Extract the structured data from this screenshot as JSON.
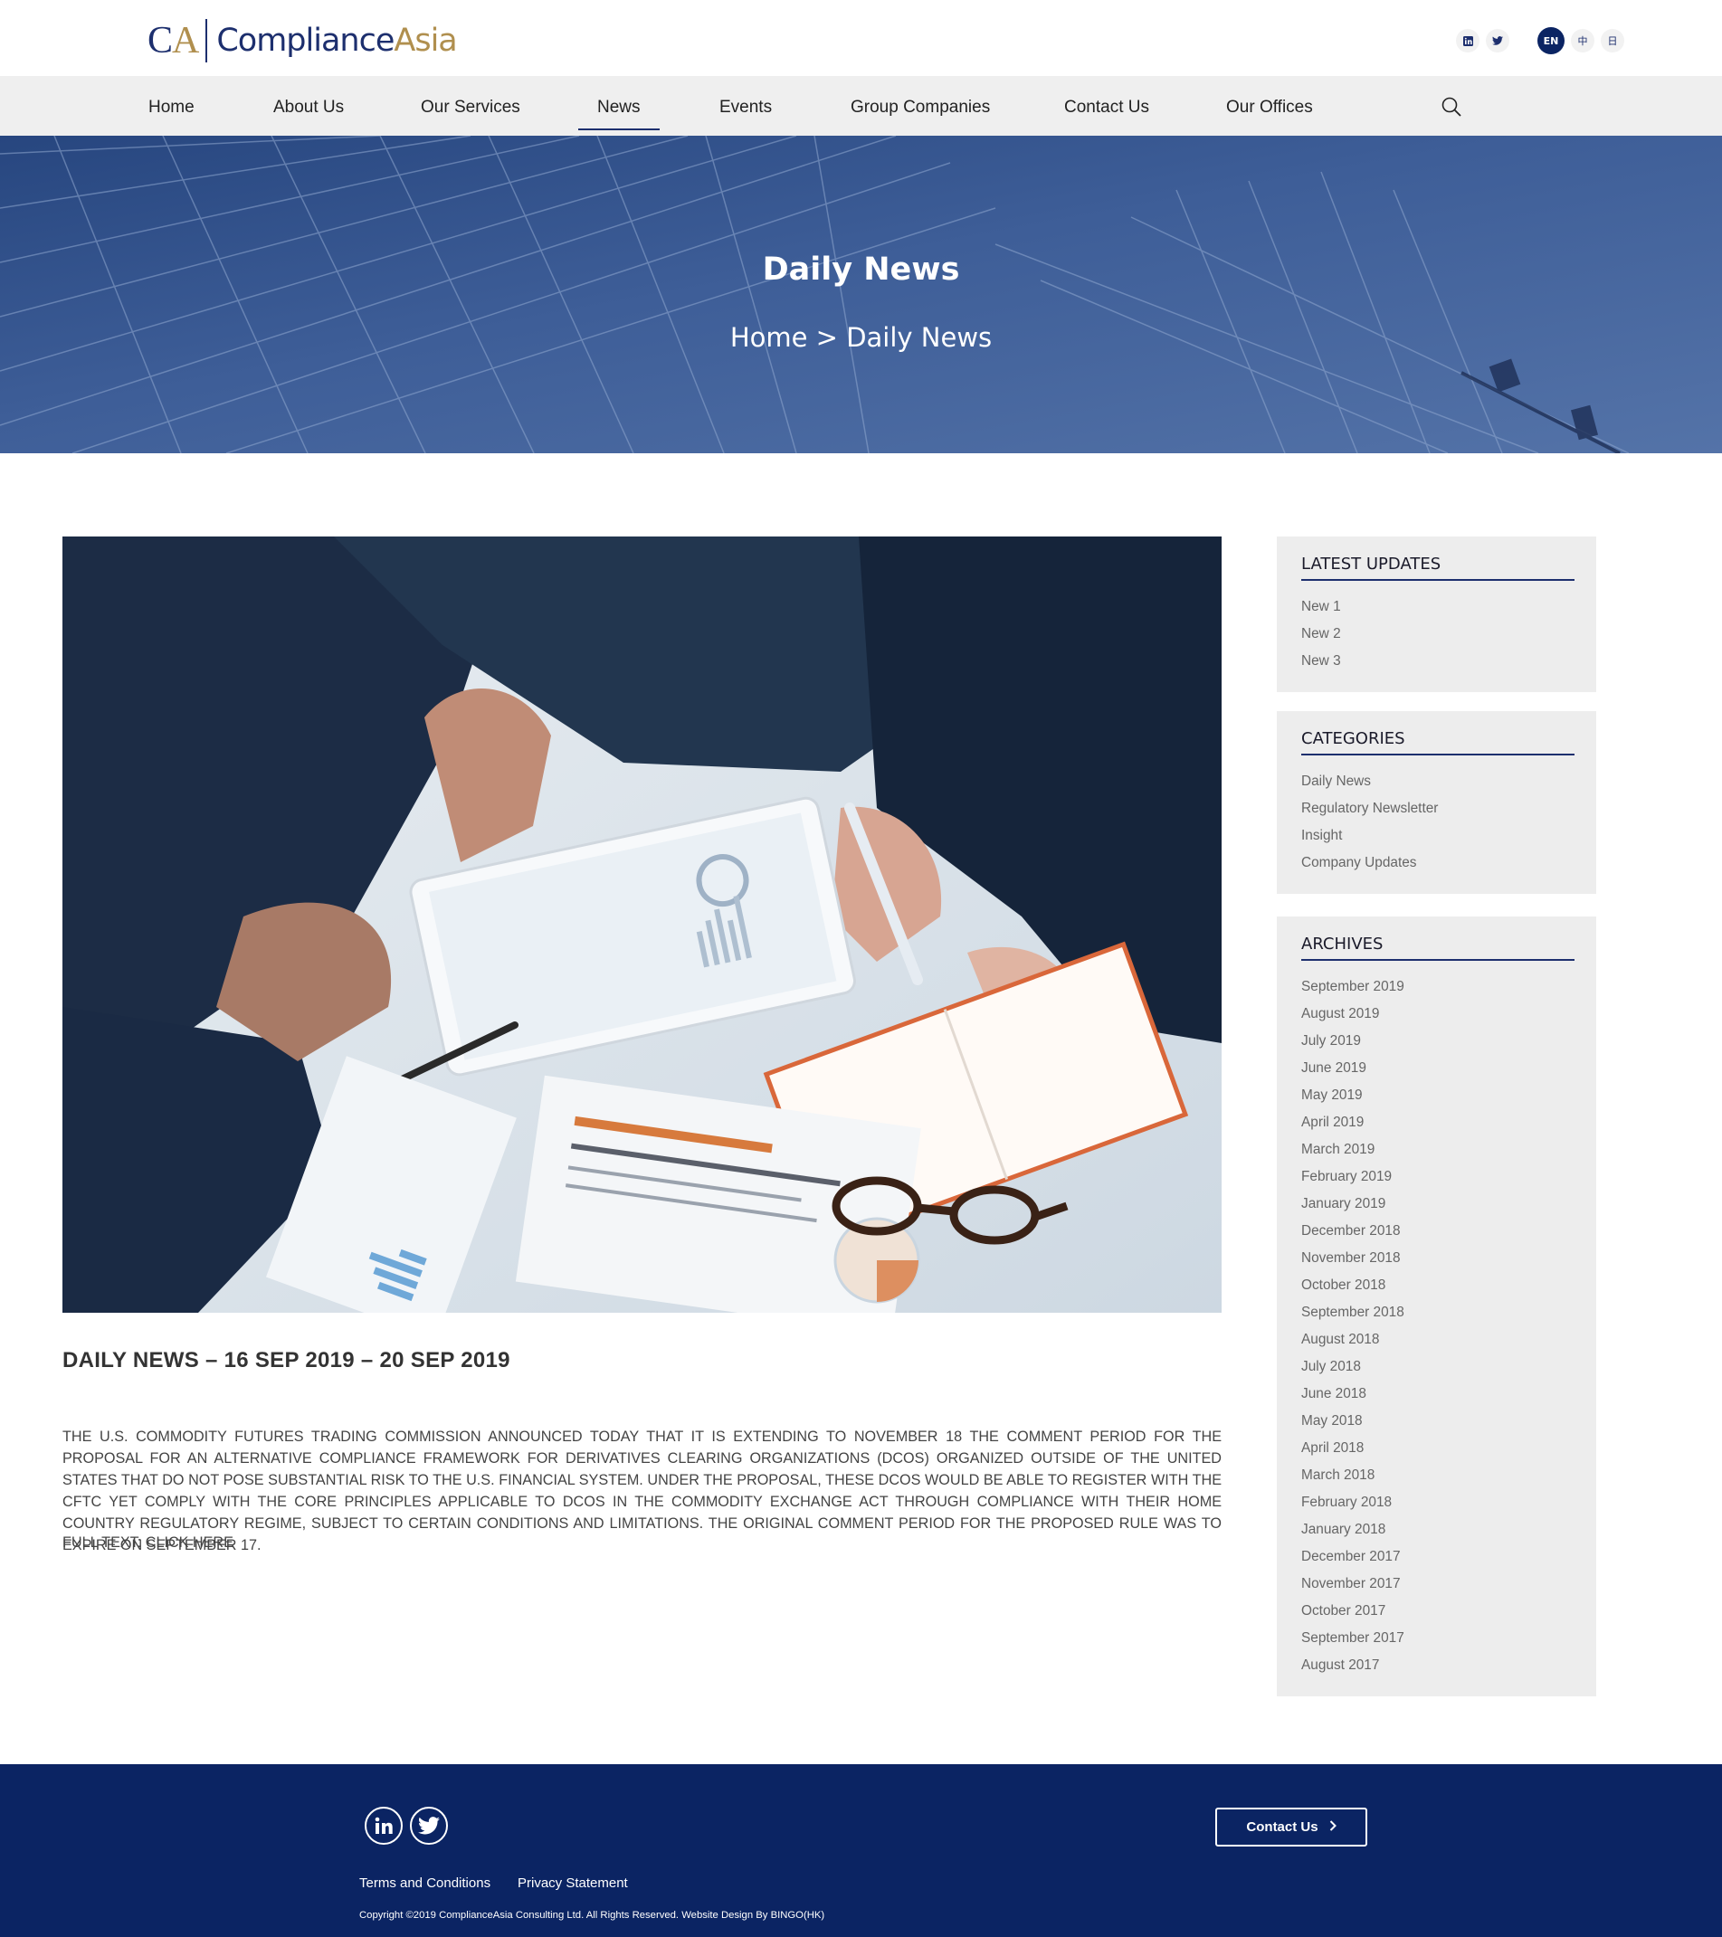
{
  "header": {
    "logo": {
      "mark_left": "C",
      "mark_right": "A",
      "name_main": "Compliance",
      "name_accent": "Asia"
    },
    "social_icons": [
      "linkedin-icon",
      "twitter-icon"
    ],
    "languages": {
      "active": "EN",
      "chinese": "中",
      "japanese": "日"
    }
  },
  "nav": {
    "items": [
      "Home",
      "About Us",
      "Our Services",
      "News",
      "Events",
      "Group Companies",
      "Contact Us",
      "Our Offices"
    ],
    "active": "News",
    "search_icon": "search-icon"
  },
  "banner": {
    "title": "Daily News",
    "breadcrumb": "Home > Daily News"
  },
  "article": {
    "title": "DAILY NEWS – 16 SEP 2019 – 20 SEP 2019",
    "body": "The U.S. Commodity Futures Trading Commission announced today that it is extending to November 18 the comment period for the proposal for an alternative compliance framework for derivatives clearing organizations (DCOs) organized outside of the United States that do not pose substantial risk to the U.S. financial system. Under the proposal, these DCOs would be able to register with the CFTC yet comply with the core principles applicable to DCOs in the Commodity Exchange Act through compliance with their home country regulatory regime, subject to certain conditions and limitations. The original comment period for the proposed rule was to expire on September 17.",
    "full_text_link": "FULL TEXT: CLICK HERE"
  },
  "sidebar": {
    "latest": {
      "title": "LATEST UPDATES",
      "items": [
        "New 1",
        "New 2",
        "New 3"
      ]
    },
    "categories": {
      "title": "CATEGORIES",
      "items": [
        "Daily News",
        "Regulatory Newsletter",
        "Insight",
        "Company Updates"
      ]
    },
    "archives": {
      "title": "ARCHIVES",
      "items": [
        "September 2019",
        "August 2019",
        "July 2019",
        "June 2019",
        "May 2019",
        "April 2019",
        "March 2019",
        "February 2019",
        "January 2019",
        "December 2018",
        "November 2018",
        "October 2018",
        "September 2018",
        "August 2018",
        "July 2018",
        "June 2018",
        "May 2018",
        "April 2018",
        "March 2018",
        "February 2018",
        "January 2018",
        "December 2017",
        "November 2017",
        "October 2017",
        "September 2017",
        "August 2017"
      ]
    }
  },
  "footer": {
    "social_icons": [
      "linkedin-icon",
      "twitter-icon"
    ],
    "contact_button": "Contact Us",
    "links": [
      "Terms and Conditions",
      "Privacy Statement"
    ],
    "copyright": "Copyright ©2019 ComplianceAsia Consulting Ltd. All Rights Reserved. Website Design By BINGO(HK)"
  },
  "colors": {
    "brand_navy": "#0b2463",
    "brand_gold": "#b08f4e",
    "banner_blue": "#3a5a94",
    "sidebar_bg": "#ededed"
  }
}
